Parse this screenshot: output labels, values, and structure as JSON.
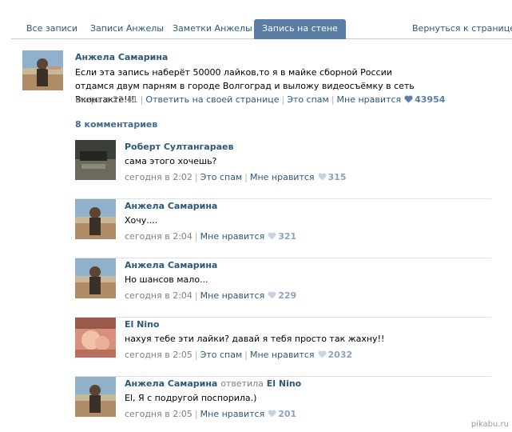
{
  "tabs": [
    {
      "label": "Все записи"
    },
    {
      "label": "Записи Анжелы"
    },
    {
      "label": "Заметки Анжелы"
    },
    {
      "label": "Запись на стене"
    },
    {
      "label": "Вернуться к странице"
    }
  ],
  "post": {
    "author": "Анжела Самарина",
    "text": "Если эта запись наберёт 50000 лайков,то я в майке сборной России отдамся двум парням в городе Волгоград и выложу видеосъёмку в сеть Вконтакте!!!",
    "time": "вчера в 22:41",
    "reply_link": "Ответить на своей странице",
    "spam_link": "Это спам",
    "like_link": "Мне нравится",
    "likes": "43954"
  },
  "comments_count": "8 комментариев",
  "comments": [
    {
      "author": "Роберт Султангараев",
      "text": "сама этого хочешь?",
      "time": "сегодня в 2:02",
      "spam": "Это спам",
      "like": "Мне нравится",
      "likes": "315"
    },
    {
      "author": "Анжела Самарина",
      "text": "Хочу....",
      "time": "сегодня в 2:04",
      "like": "Мне нравится",
      "likes": "321"
    },
    {
      "author": "Анжела Самарина",
      "text": "Но шансов мало...",
      "time": "сегодня в 2:04",
      "like": "Мне нравится",
      "likes": "229"
    },
    {
      "author": "El Nino",
      "text": "нахуя тебе эти лайки? давай я тебя просто так жахну!!",
      "time": "сегодня в 2:05",
      "spam": "Это спам",
      "like": "Мне нравится",
      "likes": "2032"
    },
    {
      "author": "Анжела Самарина",
      "reply_word": "ответила",
      "reply_to": "El Nino",
      "text": "El, Я с подругой поспорила.)",
      "time": "сегодня в 2:05",
      "like": "Мне нравится",
      "likes": "201"
    }
  ],
  "watermark": "pikabu.ru",
  "colors": {
    "link": "#2b587a",
    "active_tab": "#597da3",
    "muted": "#808080"
  }
}
